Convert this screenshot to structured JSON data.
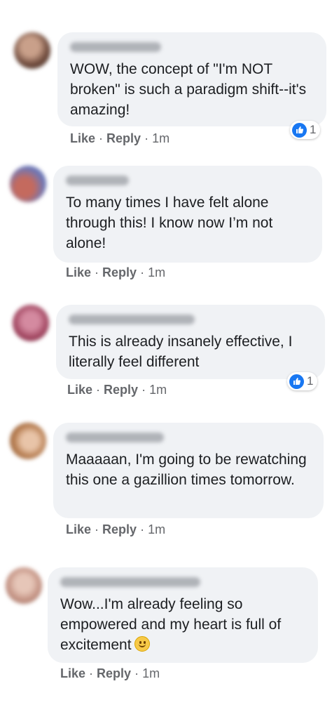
{
  "comments": [
    {
      "text": "WOW, the concept of \"I'm NOT broken\" is such a paradigm shift--it's amazing!",
      "actions": {
        "like": "Like",
        "reply": "Reply",
        "sep": "·",
        "time": "1m"
      },
      "reactions": {
        "icon": "thumbs-up-icon",
        "count": "1"
      },
      "avatar_color": "#8b6a5a"
    },
    {
      "text": "To many times I have felt alone through this! I know now I’m not alone!",
      "actions": {
        "like": "Like",
        "reply": "Reply",
        "sep": "·",
        "time": "1m"
      },
      "avatar_color": "#7a7fb0"
    },
    {
      "text": "This is already insanely effective, I literally feel different",
      "actions": {
        "like": "Like",
        "reply": "Reply",
        "sep": "·",
        "time": "1m"
      },
      "reactions": {
        "icon": "thumbs-up-icon",
        "count": "1"
      },
      "avatar_color": "#a0485e"
    },
    {
      "text": "Maaaaan, I'm going to be rewatching this one a gazillion times tomorrow.",
      "actions": {
        "like": "Like",
        "reply": "Reply",
        "sep": "·",
        "time": "1m"
      },
      "avatar_color": "#b9845c"
    },
    {
      "text": "Wow...I'm already feeling so empowered and my heart is full of excitement",
      "emoji": "slightly-smiling-face-icon",
      "actions": {
        "like": "Like",
        "reply": "Reply",
        "sep": "·",
        "time": "1m"
      },
      "avatar_color": "#c79a8c"
    }
  ],
  "colors": {
    "bubble": "#f0f2f5",
    "meta_text": "#65676b",
    "like_blue": "#1877f2"
  }
}
